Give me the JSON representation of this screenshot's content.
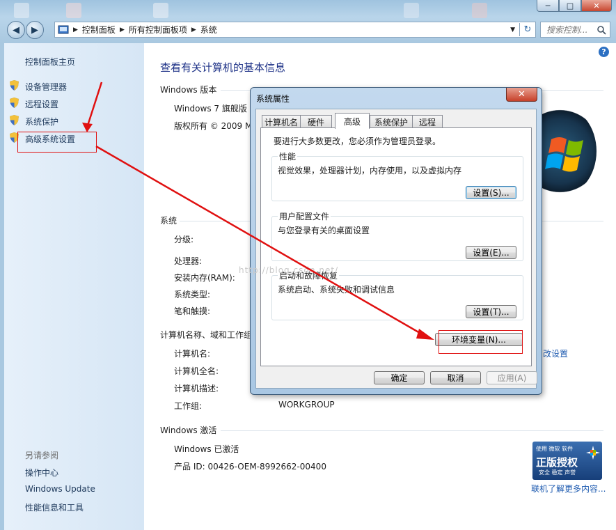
{
  "window": {
    "address": [
      "控制面板",
      "所有控制面板项",
      "系统"
    ],
    "search_placeholder": "搜索控制...",
    "buttons": {
      "minimize": "─",
      "maximize": "□",
      "close": "✕",
      "back": "◀",
      "forward": "▶",
      "refresh": "↻"
    }
  },
  "left_pane": {
    "home": "控制面板主页",
    "items": [
      {
        "label": "设备管理器",
        "icon": "shield-icon"
      },
      {
        "label": "远程设置",
        "icon": "shield-icon"
      },
      {
        "label": "系统保护",
        "icon": "shield-icon"
      },
      {
        "label": "高级系统设置",
        "icon": "shield-icon"
      }
    ],
    "see_also_title": "另请参阅",
    "see_also": [
      "操作中心",
      "Windows Update",
      "性能信息和工具"
    ]
  },
  "main": {
    "title": "查看有关计算机的基本信息",
    "edition_section": "Windows 版本",
    "edition": "Windows 7 旗舰版",
    "copyright": "版权所有 © 2009 M",
    "system_section": "系统",
    "system_labels": [
      "分级:",
      "处理器:",
      "安装内存(RAM):",
      "系统类型:",
      "笔和触摸:"
    ],
    "computer_section": "计算机名称、域和工作组",
    "computer_labels": [
      "计算机名:",
      "计算机全名:",
      "计算机描述:",
      "工作组:"
    ],
    "workgroup_value": "WORKGROUP",
    "change_settings": "改设置",
    "activation_section": "Windows 激活",
    "activated": "Windows 已激活",
    "product_id": "产品 ID: 00426-OEM-8992662-00400",
    "genuine": {
      "top": "使用 微软 软件",
      "big": "正版授权",
      "sub": "安全 稳定 声誉"
    },
    "learn_more": "联机了解更多内容..."
  },
  "dialog": {
    "title": "系统属性",
    "tabs": [
      "计算机名",
      "硬件",
      "高级",
      "系统保护",
      "远程"
    ],
    "active_tab": "高级",
    "admin_note": "要进行大多数更改，您必须作为管理员登录。",
    "groups": [
      {
        "title": "性能",
        "desc": "视觉效果，处理器计划，内存使用，以及虚拟内存",
        "button": "设置(S)..."
      },
      {
        "title": "用户配置文件",
        "desc": "与您登录有关的桌面设置",
        "button": "设置(E)..."
      },
      {
        "title": "启动和故障恢复",
        "desc": "系统启动、系统失败和调试信息",
        "button": "设置(T)..."
      }
    ],
    "env_button": "环境变量(N)...",
    "ok": "确定",
    "cancel": "取消",
    "apply": "应用(A)"
  },
  "watermark": "http://blog.csdn.net/",
  "colors": {
    "annotation": "#e01010",
    "link": "#1e395b",
    "title": "#1e3287"
  }
}
